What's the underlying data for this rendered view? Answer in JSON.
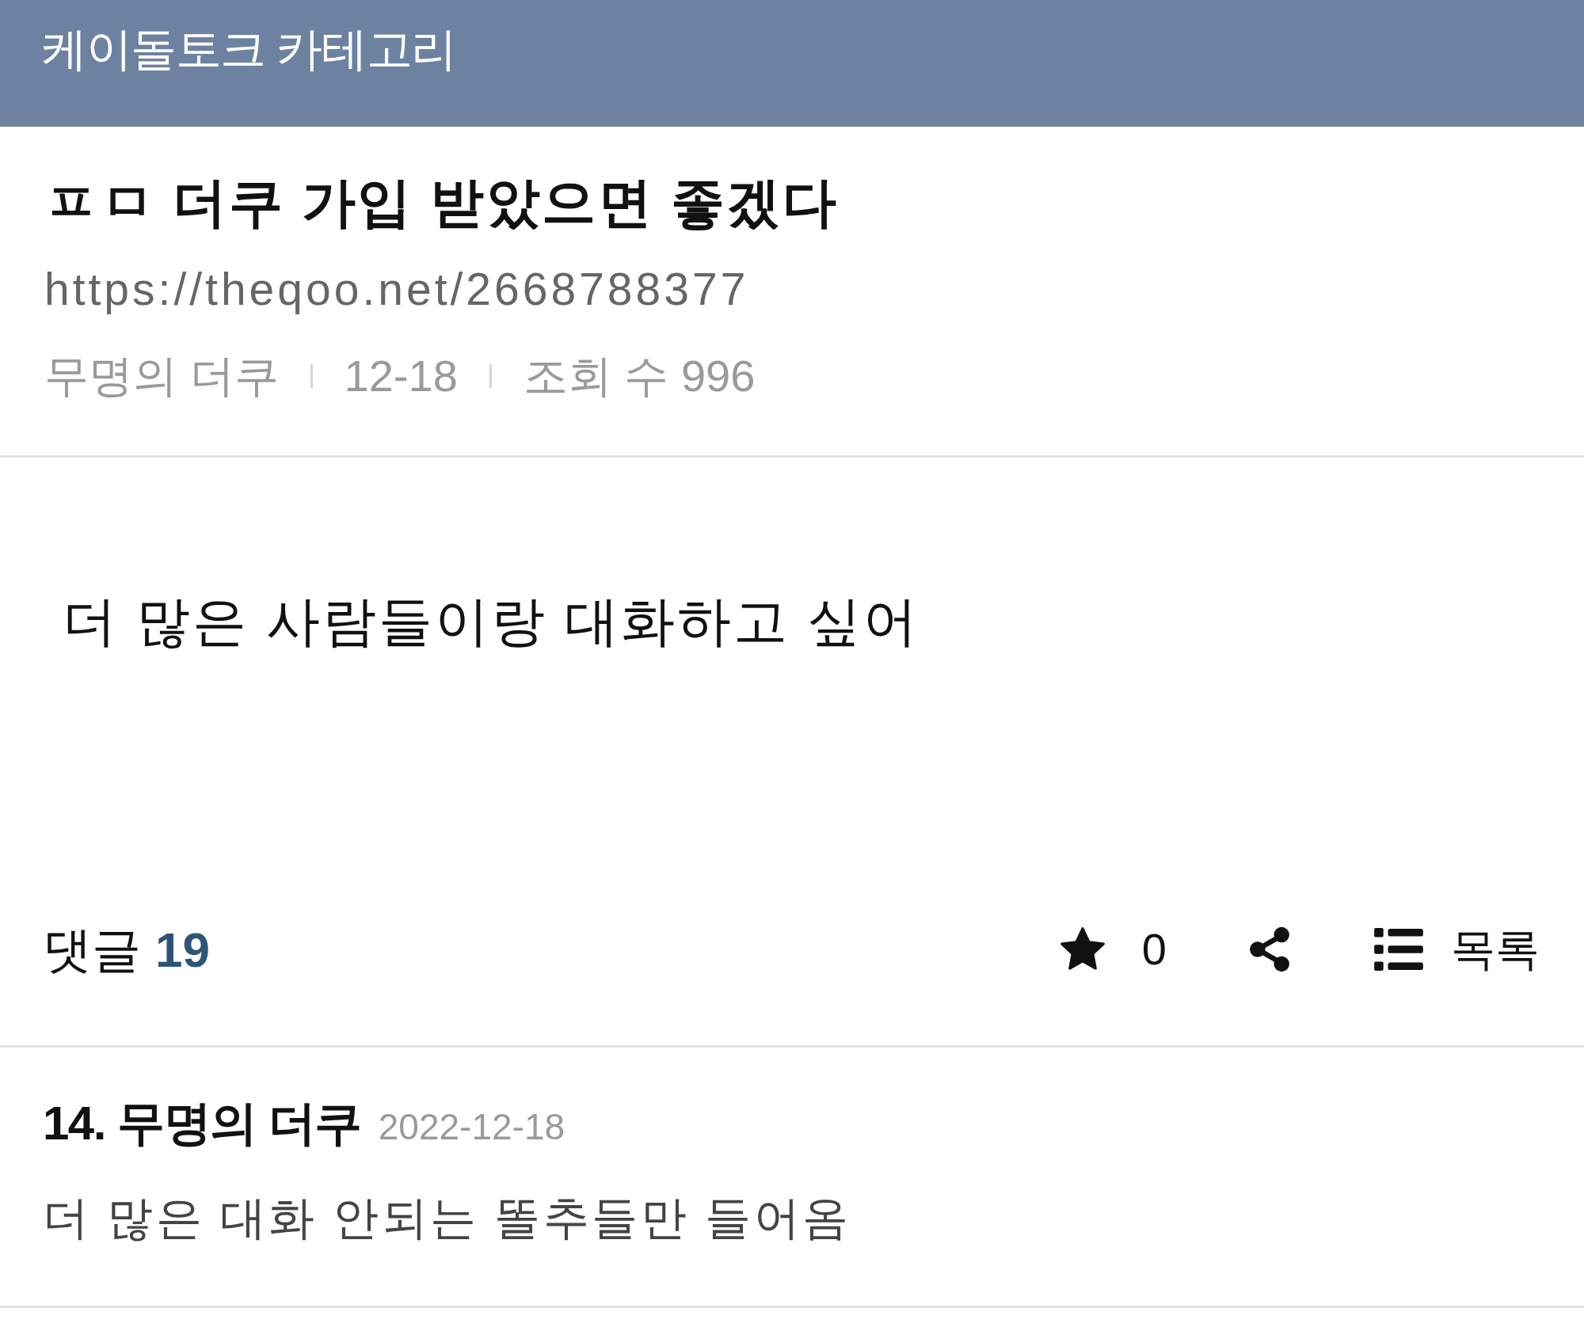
{
  "header": {
    "title": "케이돌토크 카테고리"
  },
  "post": {
    "title": "ㅍㅁ 더쿠 가입 받았으면 좋겠다",
    "url": "https://theqoo.net/2668788377",
    "meta": [
      "무명의 더쿠",
      "12-18",
      "조회 수 996"
    ],
    "body": "더 많은 사람들이랑 대화하고 싶어"
  },
  "actions": {
    "comments_label": "댓글",
    "comments_count": "19",
    "star_count": "0",
    "list_label": "목록"
  },
  "comments": [
    {
      "heading": "14. 무명의 더쿠",
      "date": "2022-12-18",
      "text": "더 많은 대화 안되는 똘추들만 들어옴"
    }
  ]
}
